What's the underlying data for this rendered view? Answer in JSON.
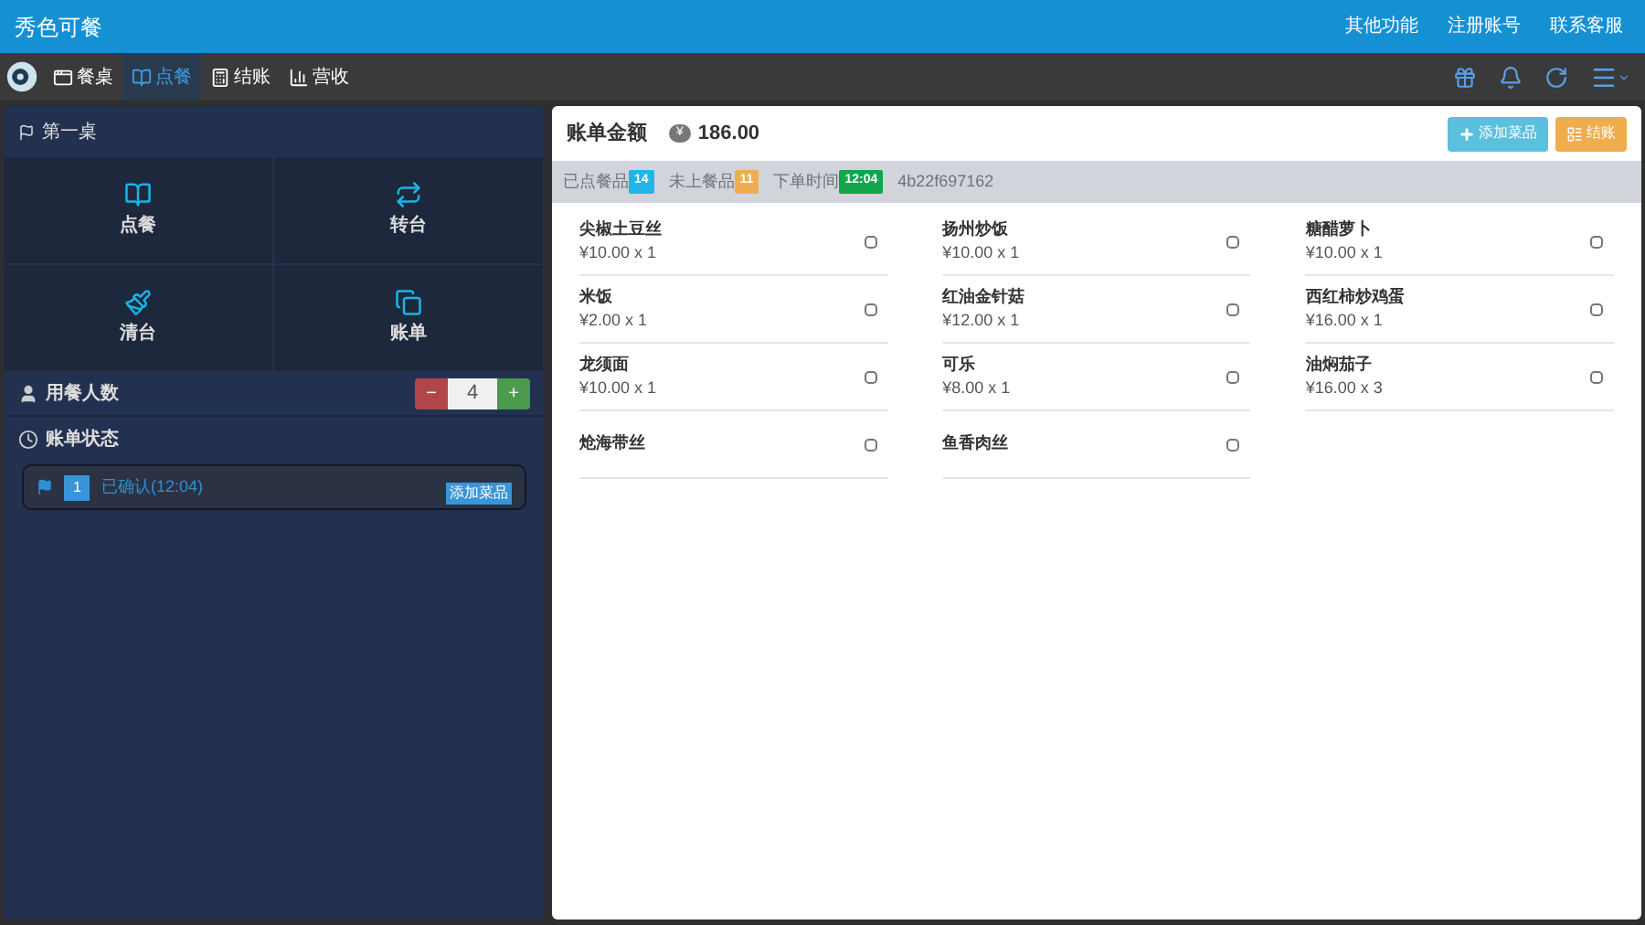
{
  "app_title": "秀色可餐",
  "top_links": [
    "其他功能",
    "注册账号",
    "联系客服"
  ],
  "nav_tabs": [
    {
      "label": "餐桌",
      "selected": false
    },
    {
      "label": "点餐",
      "selected": true
    },
    {
      "label": "结账",
      "selected": false
    },
    {
      "label": "营收",
      "selected": false
    }
  ],
  "table_panel": {
    "title": "第一桌",
    "actions": [
      {
        "label": "点餐"
      },
      {
        "label": "转台"
      },
      {
        "label": "清台"
      },
      {
        "label": "账单"
      }
    ],
    "guests": {
      "label": "用餐人数",
      "minus": "−",
      "value": "4",
      "plus": "+"
    },
    "status": {
      "label": "账单状态",
      "entries": [
        {
          "number": "1",
          "text": "已确认(12:04)",
          "badge": "添加菜品"
        }
      ]
    }
  },
  "bill": {
    "title": "账单金额",
    "currency": "¥",
    "amount": "186.00",
    "add_button": "添加菜品",
    "checkout_button": "结账",
    "stats": [
      {
        "label": "已点餐品",
        "badge": "14",
        "color": "#1fb5e8"
      },
      {
        "label": "未上餐品",
        "badge": "11",
        "color": "#f0ad4e"
      },
      {
        "label": "下单时间",
        "badge": "12:04",
        "color": "#10a64a"
      }
    ],
    "order_id": "4b22f697162",
    "dishes": [
      {
        "name": "尖椒土豆丝",
        "price": "¥10.00 x 1",
        "checked": false
      },
      {
        "name": "扬州炒饭",
        "price": "¥10.00 x 1",
        "checked": false
      },
      {
        "name": "糖醋萝卜",
        "price": "¥10.00 x 1",
        "checked": false
      },
      {
        "name": "米饭",
        "price": "¥2.00 x 1",
        "checked": false
      },
      {
        "name": "红油金针菇",
        "price": "¥12.00 x 1",
        "checked": false
      },
      {
        "name": "西红柿炒鸡蛋",
        "price": "¥16.00 x 1",
        "checked": false
      },
      {
        "name": "龙须面",
        "price": "¥10.00 x 1",
        "checked": false
      },
      {
        "name": "可乐",
        "price": "¥8.00 x 1",
        "checked": false
      },
      {
        "name": "油焖茄子",
        "price": "¥16.00 x 3",
        "checked": false
      },
      {
        "name": "炝海带丝",
        "checked": false
      },
      {
        "name": "鱼香肉丝",
        "checked": false
      }
    ]
  }
}
